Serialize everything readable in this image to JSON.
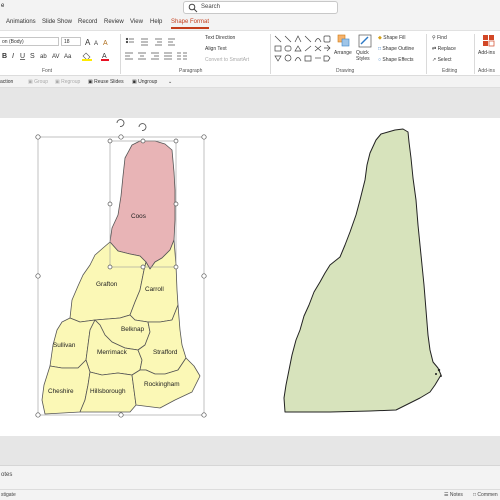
{
  "titlebar": {
    "partial_title": "e",
    "search_placeholder": "Search"
  },
  "tabs": [
    {
      "label": "Animations",
      "active": false
    },
    {
      "label": "Slide Show",
      "active": false
    },
    {
      "label": "Record",
      "active": false
    },
    {
      "label": "Review",
      "active": false
    },
    {
      "label": "View",
      "active": false
    },
    {
      "label": "Help",
      "active": false
    },
    {
      "label": "Shape Format",
      "active": true
    }
  ],
  "ribbon": {
    "font": {
      "font_name": "on (Body)",
      "font_size": "18",
      "group_label": "Font"
    },
    "paragraph": {
      "text_direction": "Text Direction",
      "align_text": "Align Text",
      "convert_smartart": "Convert to SmartArt",
      "group_label": "Paragraph"
    },
    "drawing": {
      "arrange": "Arrange",
      "quick_styles": "Quick Styles",
      "shape_fill": "Shape Fill",
      "shape_outline": "Shape Outline",
      "shape_effects": "Shape Effects",
      "group_label": "Drawing"
    },
    "editing": {
      "find": "Find",
      "replace": "Replace",
      "select": "Select",
      "group_label": "Editing"
    },
    "addins": {
      "label": "Add-ins",
      "group_label": "Add-ins"
    }
  },
  "quick_bar": {
    "items": [
      {
        "label": "action",
        "disabled": false
      },
      {
        "label": "Group",
        "disabled": true
      },
      {
        "label": "Regroup",
        "disabled": true
      },
      {
        "label": "Reuse Slides",
        "disabled": false
      },
      {
        "label": "Ungroup",
        "disabled": false
      }
    ]
  },
  "slide": {
    "counties": {
      "coos": "Coos",
      "grafton": "Grafton",
      "carroll": "Carroll",
      "belknap": "Belknap",
      "sullivan": "Sullivan",
      "merrimack": "Merrimack",
      "strafford": "Strafford",
      "cheshire": "Cheshire",
      "hillsborough": "Hillsborough",
      "rockingham": "Rockingham"
    },
    "colors": {
      "county_fill": "#fbf8b6",
      "selected_fill": "#e8b4b6",
      "state_fill": "#d7e3bc"
    }
  },
  "notes": {
    "label": "otes"
  },
  "status": {
    "left_text": "stigate",
    "notes_btn": "Notes",
    "comments_btn": "Commen"
  }
}
